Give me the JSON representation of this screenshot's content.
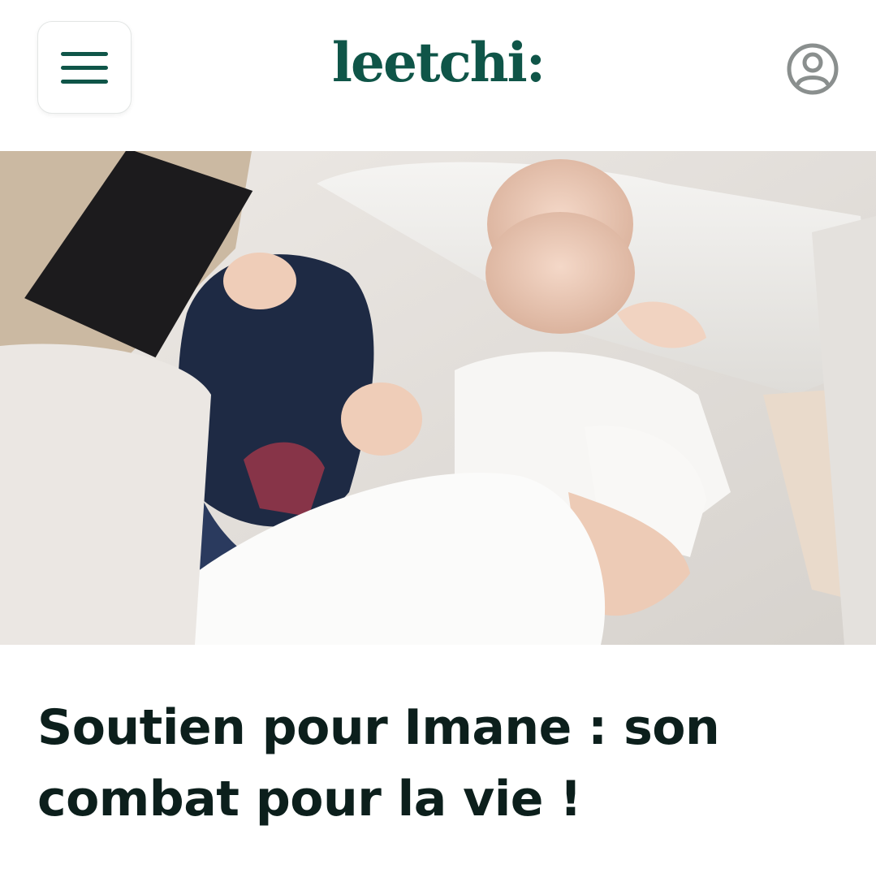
{
  "header": {
    "menu_icon": "hamburger-menu-icon",
    "logo_text": "leetchi:",
    "profile_icon": "user-account-icon",
    "brand_color": "#0f5548"
  },
  "hero": {
    "image_description_icon": "campaign-photo"
  },
  "campaign": {
    "title": "Soutien pour Imane : son combat pour la vie !"
  }
}
